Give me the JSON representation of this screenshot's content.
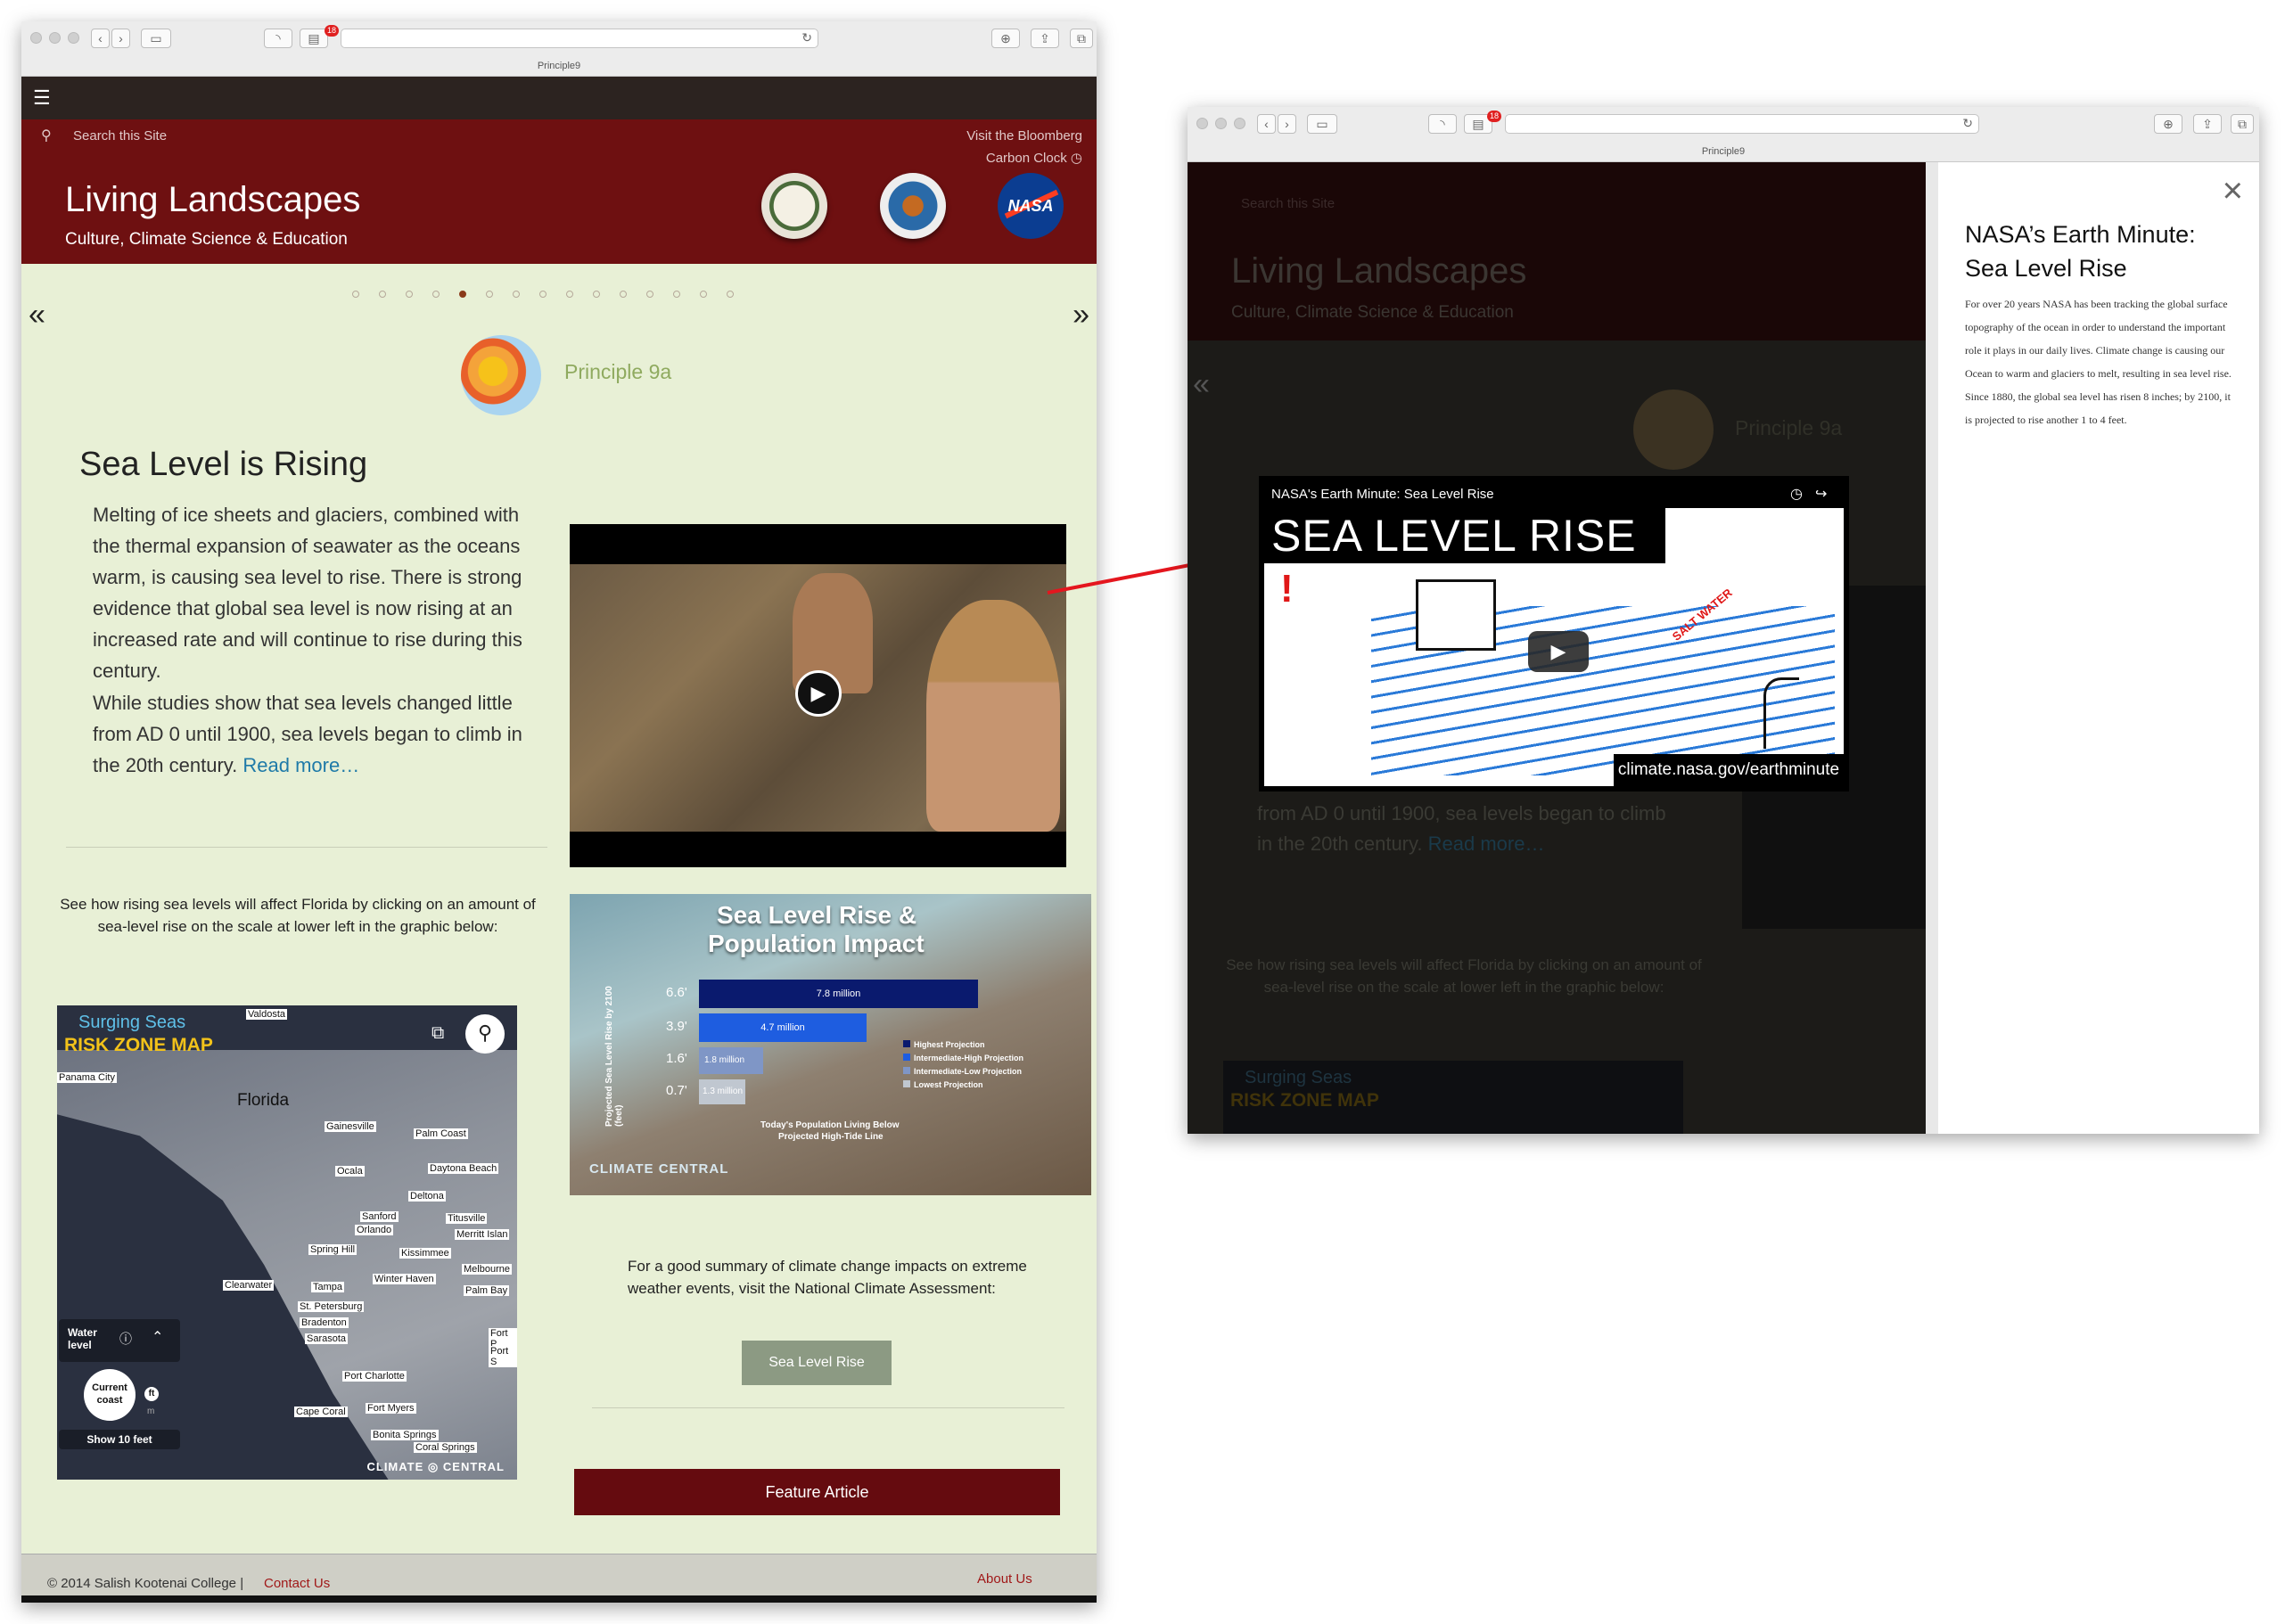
{
  "window1": {
    "tab_title": "Principle9",
    "notif_count": "18",
    "search_placeholder": "Search this Site",
    "carbon_line1": "Visit the Bloomberg",
    "carbon_line2": "Carbon Clock",
    "site_title": "Living Landscapes",
    "site_subtitle": "Culture, Climate Science & Education",
    "nasa_text": "NASA",
    "principle_label": "Principle 9a",
    "heading": "Sea Level is Rising",
    "para1": "Melting of ice sheets and glaciers, combined with the thermal expansion of seawater as the oceans warm, is causing sea level to rise. There is strong evidence that global sea level is now rising at an increased rate and will continue to rise during this century.",
    "para2": "While studies show that sea levels changed little from AD 0 until 1900, sea levels began to climb in the 20th century.",
    "read_more": "Read more…",
    "florida_text": "See how rising sea levels will affect Florida by clicking on an amount of sea-level rise on the scale at lower left in the graphic below:",
    "map": {
      "brand_line1": "Surging Seas",
      "brand_line2": "RISK ZONE MAP",
      "state": "Florida",
      "water_label_1": "Water",
      "water_label_2": "level",
      "current_1": "Current",
      "current_2": "coast",
      "unit_ft": "ft",
      "unit_m": "m",
      "show10": "Show 10 feet",
      "credit_climate": "CLIMATE",
      "credit_central": "CENTRAL",
      "cities": [
        "Valdosta",
        "Panama City",
        "Gainesville",
        "Palm Coast",
        "Ocala",
        "Daytona Beach",
        "Deltona",
        "Sanford",
        "Titusville",
        "Orlando",
        "Merritt Islan",
        "Kissimmee",
        "Clearwater",
        "Spring Hill",
        "Melbourne",
        "Tampa",
        "Winter Haven",
        "St. Petersburg",
        "Palm Bay",
        "Bradenton",
        "Fort P",
        "Sarasota",
        "Port S",
        "Port Charlotte",
        "Cape Coral",
        "Fort Myers",
        "Bonita Springs",
        "Coral Springs"
      ]
    },
    "infographic": {
      "title_1": "Sea Level Rise &",
      "title_2": "Population Impact",
      "axis_label": "Projected Sea Level Rise by 2100 (feet)",
      "ticks": [
        "6.6'",
        "3.9'",
        "1.6'",
        "0.7'"
      ],
      "bar_labels": [
        "7.8 million",
        "4.7 million",
        "1.8 million",
        "1.3 million"
      ],
      "legend": [
        "Highest Projection",
        "Intermediate-High Projection",
        "Intermediate-Low Projection",
        "Lowest Projection"
      ],
      "caption_1": "Today's Population Living Below",
      "caption_2": "Projected High-Tide Line",
      "brand": "CLIMATE CENTRAL"
    },
    "nca_text": "For a good summary of climate change impacts on extreme weather events, visit the National Climate Assessment:",
    "slr_button": "Sea Level Rise",
    "feature_button": "Feature Article",
    "footer_copyright": "© 2014 Salish Kootenai College |",
    "footer_contact": "Contact Us",
    "footer_about": "About Us"
  },
  "window2": {
    "tab_title": "Principle9",
    "notif_count": "18",
    "bg_search": "Search this Site",
    "bg_title": "Living Landscapes",
    "bg_subtitle": "Culture, Climate Science & Education",
    "bg_principle": "Principle 9a",
    "bg_text_1": "from AD 0 until 1900, sea levels began to climb",
    "bg_text_2": "in the 20th century.",
    "bg_read_more": "Read more…",
    "bg_florida": "See how rising sea levels will affect Florida by clicking on an amount of sea-level rise on the scale at lower left in the graphic below:",
    "bg_map_1": "Surging Seas",
    "bg_map_2": "RISK ZONE MAP",
    "video_title": "NASA's Earth Minute: Sea Level Rise",
    "video_banner": "SEA LEVEL RISE",
    "video_url": "climate.nasa.gov/earthminute",
    "salt_water": "SALT WATER",
    "panel_title": "NASA’s Earth Minute: Sea Level Rise",
    "panel_text": "For over 20 years NASA has been tracking the global surface topography of the ocean in order to understand the important role it plays in our daily lives. Climate change is causing our Ocean to warm and glaciers to melt, resulting in sea level rise. Since 1880, the global sea level has risen 8 inches; by 2100, it is projected to rise another 1 to 4 feet."
  },
  "colors": {
    "header_red": "#6e1011",
    "page_green": "#e8f0d6",
    "link_blue": "#1f7aa8",
    "button_gray": "#8c9a83",
    "feature_red": "#650b0f"
  }
}
